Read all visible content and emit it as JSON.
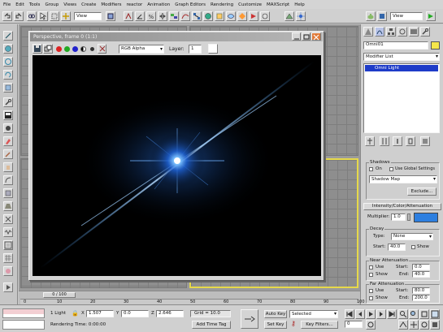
{
  "menu": [
    "File",
    "Edit",
    "Tools",
    "Group",
    "Views",
    "Create",
    "Modifiers",
    "reactor",
    "Animation",
    "Graph Editors",
    "Rendering",
    "Customize",
    "MAXScript",
    "Help"
  ],
  "toolbar": {
    "view_dropdown": "View",
    "view_dropdown_right": "View"
  },
  "frame_window": {
    "title": "Perspective, frame 0 (1:1)",
    "channel": "RGB Alpha",
    "layer_label": "Layer:",
    "layer_value": "1"
  },
  "command_panel": {
    "object_name": "Omni01",
    "modifier_list": "Modifier List",
    "stack_item": "Omni Light",
    "shadows": {
      "title": "Shadows",
      "on_label": "On",
      "use_global_label": "Use Global Settings",
      "type": "Shadow Map",
      "exclude_label": "Exclude..."
    },
    "intensity": {
      "title": "Intensity/Color/Attenuation",
      "multiplier_label": "Multiplier:",
      "multiplier_value": "1.0",
      "color": "#2d7fe0"
    },
    "decay": {
      "title": "Decay",
      "type_label": "Type:",
      "type_value": "None",
      "start_label": "Start:",
      "start_value": "40.0",
      "show_label": "Show"
    },
    "near_atten": {
      "title": "Near Attenuation",
      "use_label": "Use",
      "show_label": "Show",
      "start_label": "Start:",
      "start_value": "0.0",
      "end_label": "End:",
      "end_value": "40.0"
    },
    "far_atten": {
      "title": "Far Attenuation",
      "use_label": "Use",
      "show_label": "Show",
      "start_label": "Start:",
      "start_value": "80.0",
      "end_label": "End:",
      "end_value": "200.0"
    }
  },
  "timeline": {
    "frame_counter": "0 / 100",
    "ticks": [
      "0",
      "10",
      "20",
      "30",
      "40",
      "50",
      "60",
      "70",
      "80",
      "90",
      "100"
    ]
  },
  "status": {
    "selection": "1 Light",
    "x_label": "X",
    "x_value": "1.507",
    "y_label": "Y",
    "y_value": "0.0",
    "z_label": "Z",
    "z_value": "2.646",
    "grid": "Grid = 10.0",
    "rendering_time": "Rendering Time: 0:00:00",
    "add_time_tag": "Add Time Tag",
    "auto_key": "Auto Key",
    "set_key": "Set Key",
    "key_mode": "Selected",
    "key_filters": "Key Filters...",
    "frame": "0"
  },
  "colors": {
    "glow": "#2d80ff",
    "accent_selected": "#1e3cc8",
    "viewport_outline": "#e6d94a"
  }
}
